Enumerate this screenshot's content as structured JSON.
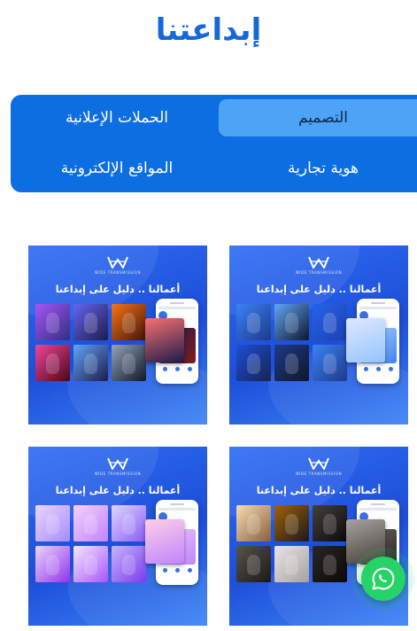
{
  "page": {
    "title": "إبداعتنا"
  },
  "tabs": [
    {
      "label": "التصميم",
      "active": true
    },
    {
      "label": "الحملات الإعلانية",
      "active": false
    },
    {
      "label": "هوية تجارية",
      "active": false
    },
    {
      "label": "المواقع الإلكترونية",
      "active": false
    }
  ],
  "portfolio": [
    {
      "headline": "أعمالنا .. دليل على إبداعنا",
      "theme": "ads",
      "thumb_colors": [
        "#1e3a8a",
        "#0f172a",
        "#1d4ed8",
        "#1e40af",
        "#172554",
        "#1e3a8a"
      ],
      "overlay_color": "#c7d2fe"
    },
    {
      "headline": "أعمالنا .. دليل على إبداعنا",
      "theme": "space",
      "thumb_colors": [
        "#4c1d95",
        "#312e81",
        "#7c2d12",
        "#831843",
        "#1e1b4b",
        "#0f172a"
      ],
      "overlay_color": "#7f1d1d"
    },
    {
      "headline": "أعمالنا .. دليل على إبداعنا",
      "theme": "perfume",
      "thumb_colors": [
        "#e7c9a9",
        "#3f2a1c",
        "#1f1f1f",
        "#2b2b2b",
        "#d6c4b0",
        "#1a1a1a"
      ],
      "overlay_color": "#6b6b6b"
    },
    {
      "headline": "أعمالنا .. دليل على إبداعنا",
      "theme": "cosmetics",
      "thumb_colors": [
        "#c4a5e8",
        "#d8b4fe",
        "#c084fc",
        "#a78bfa",
        "#ddd6fe",
        "#a855f7"
      ],
      "overlay_color": "#e9d5ff"
    }
  ],
  "colors": {
    "title": "#1667d9",
    "tab_bar": "#0d6ee2",
    "tab_active": "#4da4f7",
    "whatsapp": "#25d366"
  },
  "icons": {
    "whatsapp": "whatsapp-icon",
    "logo": "w-logo-icon"
  },
  "logo": {
    "brand_text": "WIDE TRANSMISSION"
  }
}
